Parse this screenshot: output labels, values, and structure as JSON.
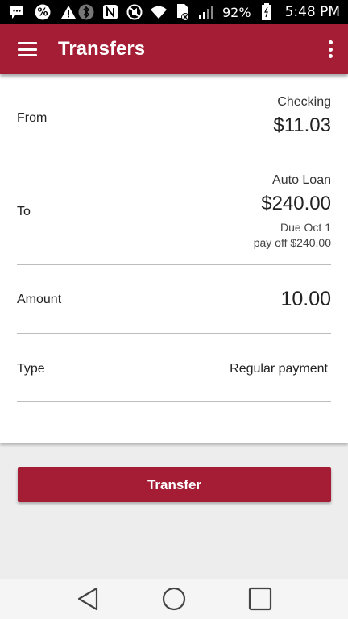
{
  "status_bar": {
    "battery_percent": "92%",
    "time": "5:48 PM",
    "left_icons": [
      "message-icon",
      "percent-icon",
      "warning-icon"
    ],
    "right_icons": [
      "bluetooth-icon",
      "nfc-icon",
      "mute-icon",
      "wifi-icon",
      "sim-icon",
      "signal-icon",
      "battery-icon"
    ]
  },
  "app_bar": {
    "title": "Transfers",
    "color": "#a41d35"
  },
  "form": {
    "from": {
      "label": "From",
      "account": "Checking",
      "amount": "$11.03"
    },
    "to": {
      "label": "To",
      "account": "Auto Loan",
      "amount": "$240.00",
      "due": "Due Oct 1",
      "payoff": "pay off $240.00"
    },
    "amount": {
      "label": "Amount",
      "value": "10.00"
    },
    "type": {
      "label": "Type",
      "value": "Regular payment"
    }
  },
  "transfer_button": {
    "label": "Transfer"
  },
  "nav_bar": {
    "icons": [
      "back-icon",
      "home-icon",
      "recents-icon"
    ]
  }
}
